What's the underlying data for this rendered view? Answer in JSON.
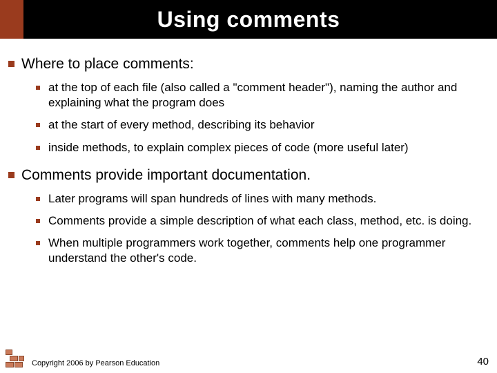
{
  "title": "Using comments",
  "sections": [
    {
      "heading": "Where to place comments:",
      "items": [
        "at the top of each file (also called a \"comment header\"), naming the author and explaining what the program does",
        "at the start of every method, describing its behavior",
        "inside methods, to explain complex pieces of code (more useful later)"
      ]
    },
    {
      "heading": "Comments provide important documentation.",
      "items": [
        "Later programs will span hundreds of lines with many methods.",
        "Comments provide a simple description of what each class, method, etc. is doing.",
        "When multiple programmers work together, comments help one programmer understand the other's code."
      ]
    }
  ],
  "footer": {
    "copyright": "Copyright 2006 by Pearson Education",
    "page": "40"
  }
}
